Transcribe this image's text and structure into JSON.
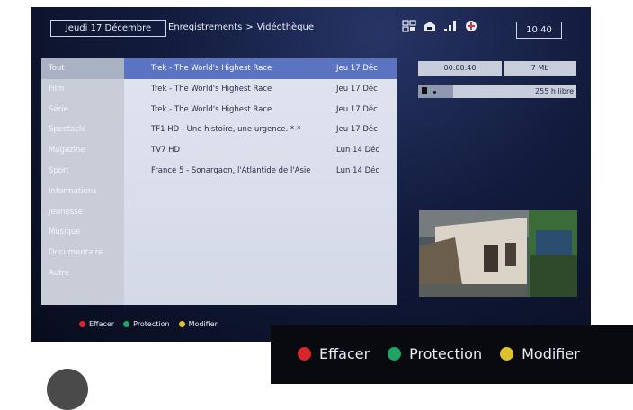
{
  "header": {
    "date": "Jeudi 17 Décembre",
    "breadcrumb_1": "Enregistrements",
    "breadcrumb_sep": ">",
    "breadcrumb_2": "Vidéothèque",
    "time": "10:40"
  },
  "categories": [
    "Tout",
    "Film",
    "Série",
    "Spectacle",
    "Magazine",
    "Sport",
    "Informations",
    "Jeunesse",
    "Musique",
    "Documentaire",
    "Autre"
  ],
  "recordings": [
    {
      "title": "Trek - The World's Highest Race",
      "date": "Jeu 17 Déc"
    },
    {
      "title": "Trek - The World's Highest Race",
      "date": "Jeu 17 Déc"
    },
    {
      "title": "Trek - The World's Highest Race",
      "date": "Jeu 17 Déc"
    },
    {
      "title": "TF1 HD - Une histoire, une urgence. *-*",
      "date": "Jeu 17 Déc"
    },
    {
      "title": "TV7 HD",
      "date": "Lun 14 Déc"
    },
    {
      "title": "France 5 - Sonargaon, l'Atlantide de l'Asie",
      "date": "Lun 14 Déc"
    }
  ],
  "info": {
    "duration": "00:00:40",
    "size": "7 Mb",
    "free_space": "255 h libre",
    "storage_used": 0.22
  },
  "legend": {
    "delete": "Effacer",
    "protect": "Protection",
    "modify": "Modifier"
  },
  "colors": {
    "delete": "#d8262a",
    "protect": "#1fa463",
    "modify": "#e0c12a",
    "selection": "#5a74c2"
  },
  "icons": [
    "hd-icon",
    "mailbox-icon",
    "signal-icon",
    "network-icon"
  ]
}
